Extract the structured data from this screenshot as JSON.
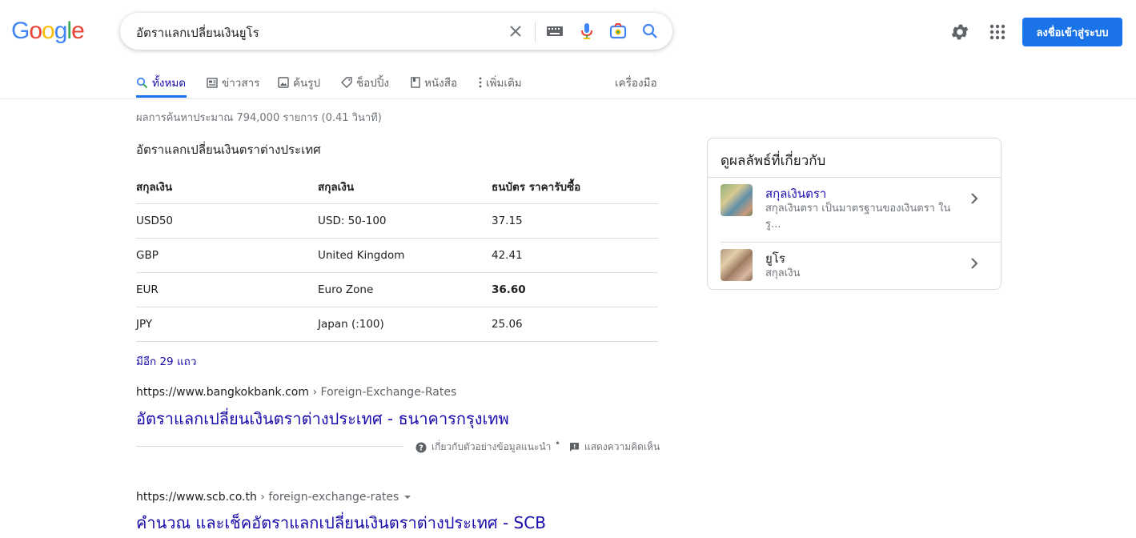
{
  "logo": {
    "letters": [
      "G",
      "o",
      "o",
      "g",
      "l",
      "e"
    ],
    "colors": [
      "#4285f4",
      "#ea4335",
      "#fbbc05",
      "#4285f4",
      "#34a853",
      "#ea4335"
    ]
  },
  "search": {
    "query": "อัตราแลกเปลี่ยนเงินยูโร"
  },
  "header": {
    "signin_label": "ลงชื่อเข้าสู่ระบบ"
  },
  "tabs": [
    {
      "label": "ทั้งหมด",
      "icon": "search-icon"
    },
    {
      "label": "ข่าวสาร",
      "icon": "news-icon"
    },
    {
      "label": "ค้นรูป",
      "icon": "image-icon"
    },
    {
      "label": "ช็อปปิ้ง",
      "icon": "tag-icon"
    },
    {
      "label": "หนังสือ",
      "icon": "book-icon"
    },
    {
      "label": "เพิ่มเติม",
      "icon": "more-vert-icon"
    }
  ],
  "tools_label": "เครื่องมือ",
  "stats": "ผลการค้นหาประมาณ 794,000 รายการ (0.41 วินาที)",
  "snippet": {
    "title": "อัตราแลกเปลี่ยนเงินตราต่างประเทศ",
    "headers": [
      "สกุลเงิน",
      "สกุลเงิน",
      "ธนบัตร ราคารับซื้อ"
    ],
    "rows": [
      [
        "USD50",
        "USD: 50-100",
        "37.15"
      ],
      [
        "GBP",
        "United Kingdom",
        "42.41"
      ],
      [
        "EUR",
        "Euro Zone",
        "36.60"
      ],
      [
        "JPY",
        "Japan (:100)",
        "25.06"
      ]
    ],
    "more_rows": "มีอีก 29 แถว"
  },
  "result1": {
    "domain": "https://www.bangkokbank.com",
    "path": " › Foreign-Exchange-Rates",
    "title": "อัตราแลกเปลี่ยนเงินตราต่างประเทศ - ธนาคารกรุงเทพ"
  },
  "feedback": {
    "about": "เกี่ยวกับตัวอย่างข้อมูลแนะนำ",
    "dot": "•",
    "feedback": "แสดงความคิดเห็น"
  },
  "result2": {
    "domain": "https://www.scb.co.th",
    "path": " › foreign-exchange-rates",
    "title": "คำนวณ และเช็คอัตราแลกเปลี่ยนเงินตราต่างประเทศ - SCB"
  },
  "panel": {
    "title": "ดูผลลัพธ์ที่เกี่ยวกับ",
    "items": [
      {
        "name": "สกุลเงินตรา",
        "desc": "สกุลเงินตรา เป็นมาตรฐานของเงินตรา ใน รู..."
      },
      {
        "name": "ยูโร",
        "desc": "สกุลเงิน"
      }
    ]
  }
}
